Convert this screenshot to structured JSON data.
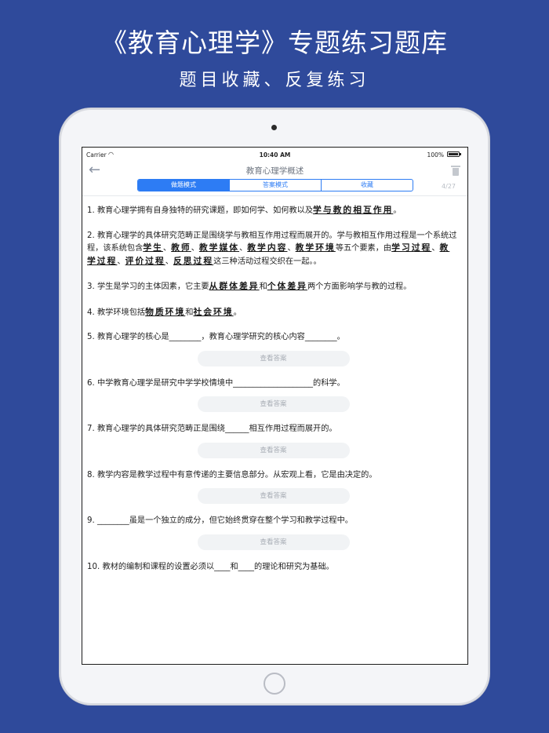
{
  "promo": {
    "title": "《教育心理学》专题练习题库",
    "subtitle": "题目收藏、反复练习"
  },
  "status_bar": {
    "carrier": "Carrier",
    "time": "10:40 AM",
    "battery": "100%"
  },
  "nav": {
    "back_icon": "←",
    "title": "教育心理学概述",
    "counter": "4/27"
  },
  "segments": [
    {
      "label": "做题模式",
      "active": true
    },
    {
      "label": "答案模式",
      "active": false
    },
    {
      "label": "收藏",
      "active": false
    }
  ],
  "check_answer_label": "查看答案",
  "questions": {
    "q1": {
      "pre": "1. 教育心理学拥有自身独特的研究课题，即如何学、如何教以及",
      "a1": "学与教的相互作用",
      "post": "。"
    },
    "q2": {
      "pre": "2. 教育心理学的具体研究范畴正是围绕学与教相互作用过程而展开的。学与教相互作用过程是一个系统过程，该系统包含",
      "a1": "学生",
      "s1": "、",
      "a2": "教师",
      "s2": "、",
      "a3": "教学媒体",
      "s3": "、",
      "a4": "教学内容",
      "s4": "、",
      "a5": "教学环境",
      "mid": "等五个要素，由",
      "a6": "学习过程",
      "s6": "、",
      "a7": "教学过程",
      "s7": "、",
      "a8": "评价过程",
      "s8": "、",
      "a9": "反思过程",
      "post": "这三种活动过程交织在一起。。"
    },
    "q3": {
      "pre": "3. 学生是学习的主体因素，它主要",
      "a1": "从群体差异",
      "mid": "和",
      "a2": "个体差异",
      "post": "两个方面影响学与教的过程。"
    },
    "q4": {
      "pre": "4. 教学环境包括",
      "a1": "物质环境",
      "mid": "和",
      "a2": "社会环境",
      "post": "。"
    },
    "q5": "5. 教育心理学的核心是________，教育心理学研究的核心内容________。",
    "q6": "6. 中学教育心理学是研究中学学校情境中____________________的科学。",
    "q7": "7. 教育心理学的具体研究范畴正是围绕______相互作用过程而展开的。",
    "q8": "8. 教学内容是教学过程中有意传递的主要信息部分。从宏观上看，它是由决定的。",
    "q9": "9. ________虽是一个独立的成分，但它始终贯穿在整个学习和教学过程中。",
    "q10": "10. 教材的编制和课程的设置必须以____和____的理论和研究为基础。"
  }
}
